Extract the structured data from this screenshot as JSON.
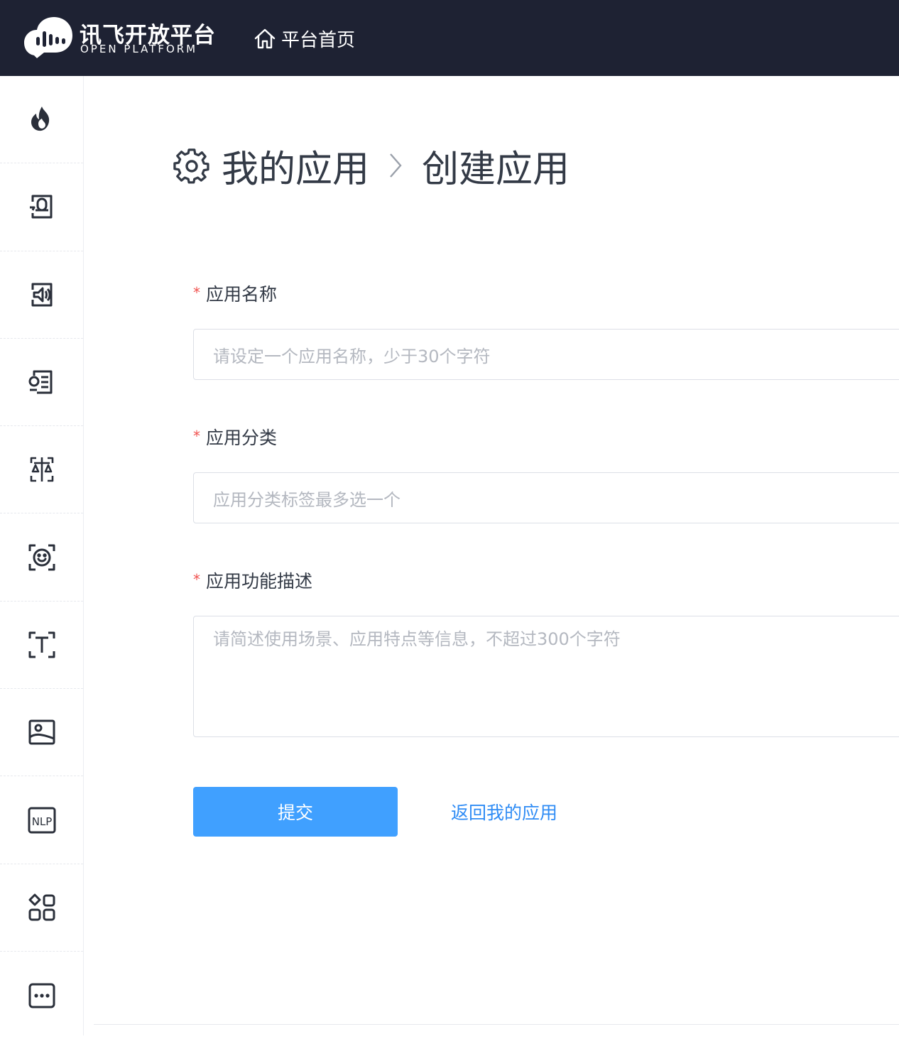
{
  "header": {
    "logo_cn": "讯飞开放平台",
    "logo_en": "OPEN PLATFORM",
    "home_label": "平台首页"
  },
  "sidebar": {
    "items": [
      {
        "icon": "flame-icon"
      },
      {
        "icon": "speech-recognition-icon"
      },
      {
        "icon": "speech-synthesis-icon"
      },
      {
        "icon": "voice-text-icon"
      },
      {
        "icon": "translation-icon"
      },
      {
        "icon": "face-recognition-icon"
      },
      {
        "icon": "text-recognition-icon"
      },
      {
        "icon": "image-icon"
      },
      {
        "icon": "nlp-icon",
        "text": "NLP"
      },
      {
        "icon": "apps-grid-icon"
      },
      {
        "icon": "more-icon"
      }
    ]
  },
  "breadcrumb": {
    "parent": "我的应用",
    "current": "创建应用"
  },
  "form": {
    "required_mark": "*",
    "name_label": "应用名称",
    "name_placeholder": "请设定一个应用名称，少于30个字符",
    "category_label": "应用分类",
    "category_placeholder": "应用分类标签最多选一个",
    "desc_label": "应用功能描述",
    "desc_placeholder": "请简述使用场景、应用特点等信息，不超过300个字符",
    "submit_label": "提交",
    "back_label": "返回我的应用"
  },
  "colors": {
    "topbar": "#1e2233",
    "accent": "#40a0ff",
    "link": "#2f8cf5",
    "required": "#f0524f"
  }
}
